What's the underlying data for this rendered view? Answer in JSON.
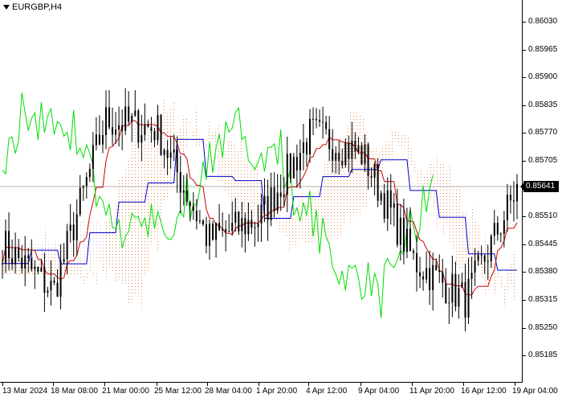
{
  "window": {
    "symbol": "EURGBP,H4"
  },
  "current_price": "0.85641",
  "colors": {
    "candle": "#000000",
    "tenkan": "#cc0000",
    "kijun": "#0000cc",
    "chikou": "#00dd00",
    "cloud_bull": "#e07b39",
    "cloud_bear": "#b07db0",
    "price_line": "#b0b0b0"
  },
  "y_axis": [
    "0.86030",
    "0.85965",
    "0.85900",
    "0.85835",
    "0.85770",
    "0.85705",
    "0.85641",
    "0.85575",
    "0.85510",
    "0.85445",
    "0.85380",
    "0.85315",
    "0.85250",
    "0.85185"
  ],
  "x_axis": [
    "13 Mar 2024",
    "18 Mar 08:00",
    "21 Mar 00:00",
    "25 Mar 12:00",
    "28 Mar 04:00",
    "1 Apr 20:00",
    "4 Apr 12:00",
    "9 Apr 04:00",
    "11 Apr 20:00",
    "16 Apr 12:00",
    "19 Apr 04:00"
  ],
  "chart_data": {
    "type": "line",
    "x": [
      "13 Mar 2024",
      "18 Mar 08:00",
      "21 Mar 00:00",
      "25 Mar 12:00",
      "28 Mar 04:00",
      "1 Apr 20:00",
      "4 Apr 12:00",
      "9 Apr 04:00",
      "11 Apr 20:00",
      "16 Apr 12:00",
      "19 Apr 04:00"
    ],
    "series": [
      {
        "values": [
          0.8551,
          0.854,
          0.858,
          0.8578,
          0.8552,
          0.8557,
          0.8577,
          0.8572,
          0.8547,
          0.8538,
          0.8564
        ]
      }
    ],
    "ylim": [
      0.85185,
      0.86065
    ],
    "last_price": 0.85641
  }
}
